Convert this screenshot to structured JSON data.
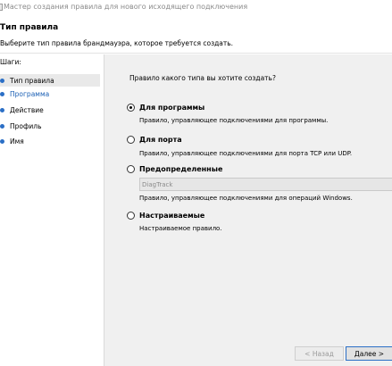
{
  "window": {
    "title": "Мастер создания правила для нового исходящего подключения"
  },
  "header": {
    "title": "Тип правила",
    "subtitle": "Выберите тип правила брандмауэра, которое требуется создать."
  },
  "steps": {
    "label": "Шаги:",
    "items": [
      {
        "label": "Тип правила"
      },
      {
        "label": "Программа"
      },
      {
        "label": "Действие"
      },
      {
        "label": "Профиль"
      },
      {
        "label": "Имя"
      }
    ]
  },
  "main": {
    "question": "Правило какого типа вы хотите создать?",
    "options": [
      {
        "label": "Для программы",
        "description": "Правило, управляющее подключениями для программы.",
        "selected": true
      },
      {
        "label": "Для порта",
        "description": "Правило, управляющее подключениями для порта TCP или UDP.",
        "selected": false
      },
      {
        "label": "Предопределенные",
        "select_value": "DiagTrack",
        "description": "Правило, управляющее подключениями для операций Windows.",
        "selected": false
      },
      {
        "label": "Настраиваемые",
        "description": "Настраиваемое правило.",
        "selected": false
      }
    ]
  },
  "buttons": {
    "back": "< Назад",
    "next": "Далее >"
  },
  "colors": {
    "step_dot": "#2b6fc6",
    "link_text": "#1a5fb4",
    "content_bg": "#f0f0f0"
  }
}
